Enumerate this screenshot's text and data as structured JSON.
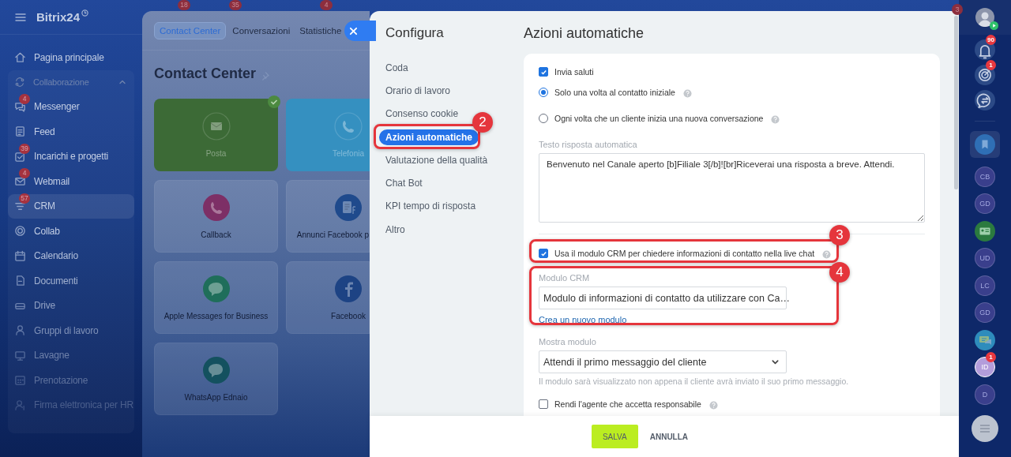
{
  "app": {
    "title": "Bitrix24"
  },
  "sidebar": {
    "items": [
      {
        "kind": "home",
        "label": "Pagina principale",
        "selected": false
      },
      {
        "kind": "group",
        "label": "Collaborazione",
        "expanded": true,
        "children": [
          {
            "kind": "chat",
            "label": "Messenger",
            "badge": "4",
            "selected": false
          },
          {
            "kind": "feed",
            "label": "Feed",
            "selected": false
          },
          {
            "kind": "tasks",
            "label": "Incarichi e progetti",
            "badge": "39",
            "selected": false
          },
          {
            "kind": "mail",
            "label": "Webmail",
            "badge": "4",
            "selected": false
          },
          {
            "kind": "crm",
            "label": "CRM",
            "badge": "57",
            "selected": true
          },
          {
            "kind": "collab",
            "label": "Collab",
            "selected": false
          },
          {
            "kind": "calendar",
            "label": "Calendario",
            "selected": false
          },
          {
            "kind": "docs",
            "label": "Documenti",
            "selected": false
          },
          {
            "kind": "drive",
            "label": "Drive",
            "selected": false
          },
          {
            "kind": "groups",
            "label": "Gruppi di lavoro",
            "selected": false
          },
          {
            "kind": "boards",
            "label": "Lavagne",
            "selected": false
          },
          {
            "kind": "booking",
            "label": "Prenotazione",
            "selected": false
          },
          {
            "kind": "sign",
            "label": "Firma elettronica per HR",
            "selected": false
          }
        ]
      }
    ]
  },
  "contact_center": {
    "counters": [
      "18",
      "35",
      "4"
    ],
    "tabs": [
      {
        "label": "Contact Center",
        "selected": true
      },
      {
        "label": "Conversazioni",
        "selected": false
      },
      {
        "label": "Statistiche",
        "selected": false
      }
    ],
    "title": "Contact Center",
    "tiles": [
      {
        "kind": "mail",
        "label": "Posta",
        "color": "#3c6a36",
        "highlighted": true,
        "connected": true
      },
      {
        "kind": "phone",
        "label": "Telefonia",
        "color": "#3590c0",
        "highlighted": true,
        "connected": false
      },
      {
        "kind": "phone",
        "label": "Callback",
        "color": "#7d2f66",
        "highlighted": false,
        "connected": false
      },
      {
        "kind": "form",
        "label": "Annunci Facebook p",
        "color": "#1f4a8c",
        "highlighted": false,
        "connected": false
      },
      {
        "kind": "bubble",
        "label": "Apple Messages for Business",
        "color": "#1f6e5a",
        "highlighted": false,
        "connected": false
      },
      {
        "kind": "facebook",
        "label": "Facebook",
        "color": "#1d4384",
        "highlighted": false,
        "connected": false
      },
      {
        "kind": "bubble",
        "label": "WhatsApp Ednaio",
        "color": "#14515f",
        "highlighted": false,
        "connected": false
      }
    ]
  },
  "settings": {
    "nav_title": "Configura",
    "nav": [
      {
        "label": "Coda",
        "selected": false
      },
      {
        "label": "Orario di lavoro",
        "selected": false
      },
      {
        "label": "Consenso cookie",
        "selected": false
      },
      {
        "label": "Azioni automatiche",
        "selected": true,
        "callout": "2"
      },
      {
        "label": "Valutazione della qualità",
        "selected": false
      },
      {
        "label": "Chat Bot",
        "selected": false
      },
      {
        "label": "KPI tempo di risposta",
        "selected": false
      },
      {
        "label": "Altro",
        "selected": false
      }
    ],
    "title": "Azioni automatiche",
    "form": [
      {
        "kind": "checkbox",
        "label": "Invia saluti",
        "checked": true,
        "help": false
      },
      {
        "kind": "radio",
        "label": "Solo una volta al contatto iniziale",
        "selected": true,
        "help": true
      },
      {
        "kind": "radio",
        "label": "Ogni volta che un cliente inizia una nuova conversazione",
        "selected": false,
        "help": true
      },
      {
        "kind": "textarea",
        "label": "Testo risposta automatica",
        "value": "Benvenuto nel Canale aperto [b]Filiale 3[/b]![br]Riceverai una risposta a breve. Attendi."
      },
      {
        "kind": "divider"
      },
      {
        "kind": "checkbox",
        "label": "Usa il modulo CRM per chiedere informazioni di contatto nella live chat",
        "checked": true,
        "help": true,
        "callout": "3"
      },
      {
        "kind": "select",
        "label": "Modulo CRM",
        "value": "Modulo di informazioni di contatto da utilizzare con Ca…",
        "link": "Crea un nuovo modulo",
        "callout": "4"
      },
      {
        "kind": "select",
        "label": "Mostra modulo",
        "value": "Attendi il primo messaggio del cliente",
        "hint": "Il modulo sarà visualizzato non appena il cliente avrà inviato il suo primo messaggio."
      },
      {
        "kind": "checkbox",
        "label": "Rendi l'agente che accetta responsabile",
        "checked": false,
        "help": true
      }
    ],
    "buttons": [
      {
        "kind": "primary",
        "label": "SALVA"
      },
      {
        "kind": "link",
        "label": "ANNULLA"
      }
    ]
  },
  "right_bar": {
    "counter": "3",
    "tools": [
      {
        "kind": "bell",
        "counter": "90"
      },
      {
        "kind": "target",
        "counter": "1"
      },
      {
        "kind": "exchange"
      }
    ],
    "chats": [
      {
        "kind": "bookmark",
        "selected": true,
        "color": "#2f6fb5"
      },
      {
        "kind": "initials",
        "text": "CB",
        "selected": false,
        "color": "#3a3f8c"
      },
      {
        "kind": "initials",
        "text": "GD",
        "selected": false,
        "color": "#3a3f8c"
      },
      {
        "kind": "card",
        "selected": false,
        "color": "#2b7a3f"
      },
      {
        "kind": "initials",
        "text": "UD",
        "selected": false,
        "color": "#3a3f8c"
      },
      {
        "kind": "initials",
        "text": "LC",
        "selected": false,
        "color": "#3a3f8c"
      },
      {
        "kind": "initials",
        "text": "GD",
        "selected": false,
        "color": "#3a3f8c"
      },
      {
        "kind": "chat",
        "selected": false,
        "color": "#2e8cbc"
      },
      {
        "kind": "initials",
        "text": "ID",
        "selected": false,
        "color": "#b39ddb",
        "counter": "1"
      },
      {
        "kind": "initials",
        "text": "D",
        "selected": false,
        "color": "#3a3f8c"
      }
    ]
  }
}
